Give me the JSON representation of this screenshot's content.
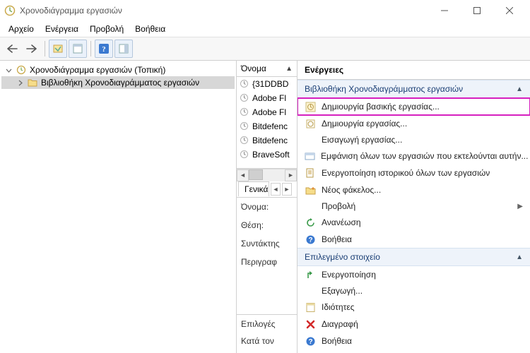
{
  "window": {
    "title": "Χρονοδιάγραμμα εργασιών"
  },
  "menu": {
    "file": "Αρχείο",
    "action": "Ενέργεια",
    "view": "Προβολή",
    "help": "Βοήθεια"
  },
  "tree": {
    "root": "Χρονοδιάγραμμα εργασιών (Τοπική)",
    "library": "Βιβλιοθήκη Χρονοδιαγράμματος εργασιών"
  },
  "list": {
    "header": "Όνομα",
    "items": [
      "{31DDBD",
      "Adobe Fl",
      "Adobe Fl",
      "Bitdefenc",
      "Bitdefenc",
      "BraveSoft"
    ]
  },
  "tabs": {
    "general": "Γενικά"
  },
  "details": {
    "name": "Όνομα:",
    "location": "Θέση:",
    "author": "Συντάκτης",
    "description": "Περιγραφ"
  },
  "options": {
    "title": "Επιλογές",
    "kata": "Κατά τον"
  },
  "actions": {
    "title": "Ενέργειες",
    "group_library": "Βιβλιοθήκη Χρονοδιαγράμματος εργασιών",
    "create_basic": "Δημιουργία βασικής εργασίας...",
    "create_task": "Δημιουργία εργασίας...",
    "import_task": "Εισαγωγή εργασίας...",
    "show_running": "Εμφάνιση όλων των εργασιών που εκτελούνται αυτήν...",
    "enable_history": "Ενεργοποίηση ιστορικού όλων των εργασιών",
    "new_folder": "Νέος φάκελος...",
    "view": "Προβολή",
    "refresh": "Ανανέωση",
    "help": "Βοήθεια",
    "group_selected": "Επιλεγμένο στοιχείο",
    "run": "Ενεργοποίηση",
    "export": "Εξαγωγή...",
    "properties": "Ιδιότητες",
    "delete": "Διαγραφή",
    "help2": "Βοήθεια"
  }
}
